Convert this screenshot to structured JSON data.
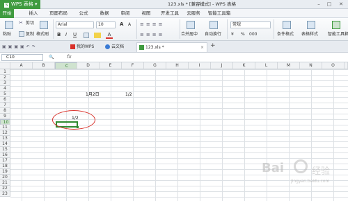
{
  "app": {
    "name": "WPS 表格",
    "title": "123.xls * [兼容模式] - WPS 表格"
  },
  "menu_tabs": [
    "开始",
    "插入",
    "页面布局",
    "公式",
    "数据",
    "审阅",
    "视图",
    "开发工具",
    "云服务",
    "智能工具箱"
  ],
  "ribbon": {
    "paste": "粘贴",
    "cut": "剪切",
    "copy": "复制",
    "format_painter": "格式刷",
    "font_name": "Arial",
    "font_size": "10",
    "bold": "B",
    "italic": "I",
    "underline": "U",
    "grow_font": "A",
    "shrink_font": "A",
    "merge_center": "合并居中",
    "wrap_text": "自动换行",
    "number_format": "常规",
    "currency": "¥",
    "percent": "%",
    "comma": "000",
    "conditional_format": "条件格式",
    "table_style": "表格样式",
    "smart_toolbox": "智能工具箱"
  },
  "doc_tabs": [
    {
      "label": "我的WPS"
    },
    {
      "label": "云文档"
    },
    {
      "label": "123.xls *"
    }
  ],
  "formula_bar": {
    "cell_ref": "C10",
    "fx": "fx",
    "content": ""
  },
  "columns": [
    "A",
    "B",
    "C",
    "D",
    "E",
    "F",
    "G",
    "H",
    "I",
    "J",
    "K",
    "L",
    "M",
    "N",
    "O"
  ],
  "rows": [
    "1",
    "2",
    "3",
    "4",
    "5",
    "6",
    "7",
    "8",
    "9",
    "10",
    "11",
    "12",
    "13",
    "14",
    "15",
    "16",
    "17",
    "18",
    "19",
    "20",
    "21",
    "22",
    "23"
  ],
  "cells": {
    "D5": "1月2日",
    "F5": "1/2",
    "C9": "1/2"
  },
  "selected_cell": "C10",
  "watermark": {
    "brand": "Bai",
    "brand2": "经验",
    "sub": "jingyan.baidu.com"
  },
  "colors": {
    "accent": "#3f9b3f",
    "annotation": "#d9312b"
  }
}
